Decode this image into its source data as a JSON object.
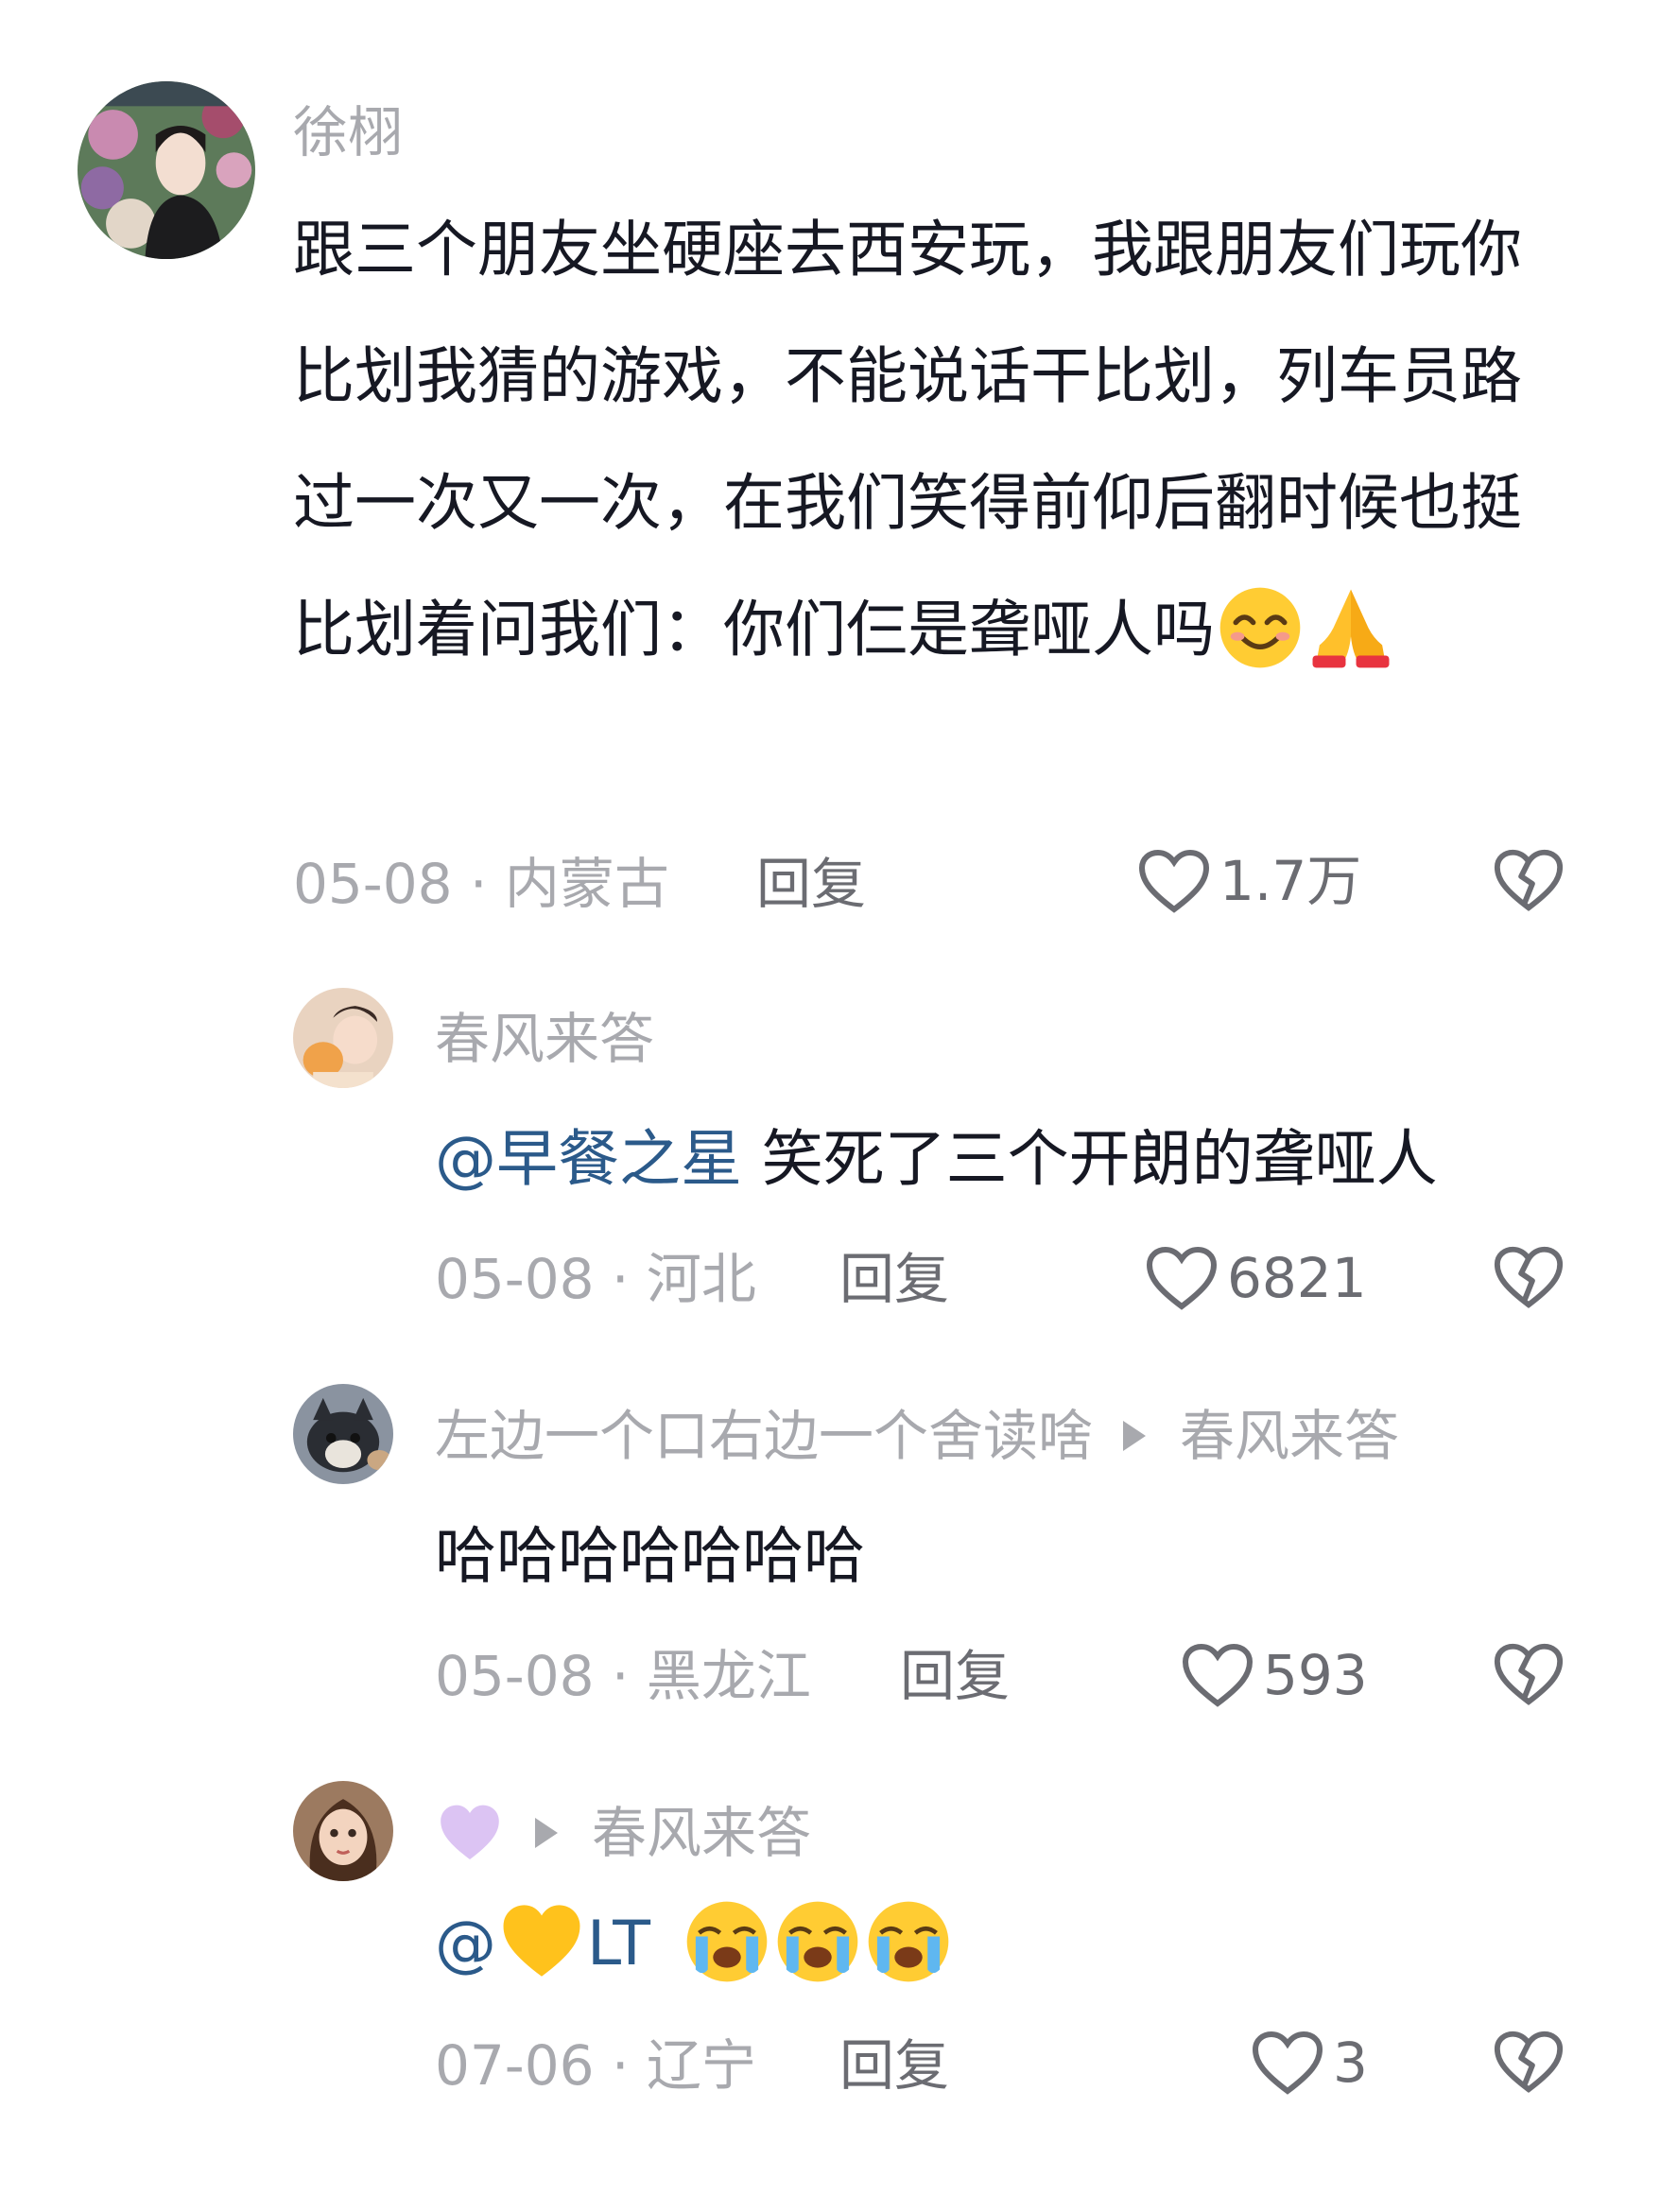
{
  "comments": [
    {
      "username": "徐栩",
      "text": "跟三个朋友坐硬座去西安玩，我跟朋友们玩你比划我猜的游戏，不能说话干比划，列车员路过一次又一次，在我们笑得前仰后翻时候也挺比划着问我们：你们仨是聋哑人吗",
      "emojis": [
        "smiling-face-emoji",
        "folded-hands-emoji"
      ],
      "meta": "05-08 · 内蒙古",
      "reply_label": "回复",
      "likes": "1.7万"
    },
    {
      "username": "春风来答",
      "mention": "@早餐之星",
      "text": " 笑死了三个开朗的聋哑人",
      "meta": "05-08 · 河北",
      "reply_label": "回复",
      "likes": "6821"
    },
    {
      "username": "左边一个口右边一个舍读啥",
      "reply_to": "春风来答",
      "text": "哈哈哈哈哈哈哈",
      "meta": "05-08 · 黑龙江",
      "reply_label": "回复",
      "likes": "593"
    },
    {
      "username_emoji": "purple-heart-emoji",
      "reply_to": "春风来答",
      "mention_prefix": "@",
      "mention_emoji": "yellow-heart-emoji",
      "mention_name": "LT",
      "emojis": [
        "crying-face-emoji",
        "crying-face-emoji",
        "crying-face-emoji"
      ],
      "meta": "07-06 · 辽宁",
      "reply_label": "回复",
      "likes": "3"
    }
  ],
  "colors": {
    "username": "#a8a9ae",
    "body": "#161823",
    "mention": "#2b5a8a",
    "action": "#6b6c72"
  }
}
